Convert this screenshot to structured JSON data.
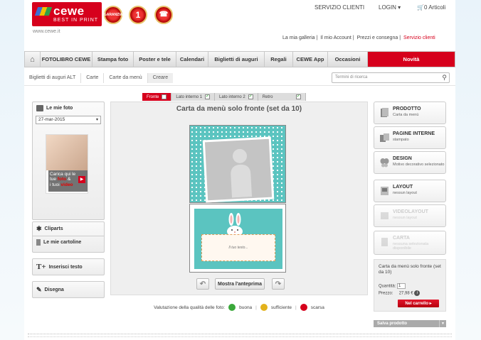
{
  "header": {
    "logo_word": "cewe",
    "logo_tag": "BEST IN PRINT",
    "site_url": "www.cewe.it",
    "badges": [
      {
        "icon": "garanzia-badge-icon",
        "label": "GARANZIA"
      },
      {
        "icon": "number-one-badge-icon",
        "label": "1"
      },
      {
        "icon": "phone-badge-icon",
        "label": "☎"
      }
    ],
    "servizio_clienti": "SERVIZIO CLIENTI",
    "login": "LOGIN",
    "cart": "0 Articoli",
    "sub_links": [
      "La mia galleria",
      "Il mio Account",
      "Prezzi e consegna",
      "Servizio clienti"
    ]
  },
  "nav": {
    "home_icon": "home-icon",
    "items": [
      "FOTOLIBRO CEWE",
      "Stampa foto",
      "Poster e tele",
      "Calendari",
      "Biglietti di auguri",
      "Regali",
      "CEWE App",
      "Occasioni",
      "Novità"
    ]
  },
  "breadcrumb": [
    "Biglietti di auguri ALT",
    "Carte",
    "Carte da menù",
    "Creare"
  ],
  "search": {
    "placeholder": "Termini di ricerca",
    "icon": "search-icon"
  },
  "tabs": [
    {
      "label": "Fronte",
      "checked": false
    },
    {
      "label": "Lato interno 1",
      "checked": true
    },
    {
      "label": "Lato interno 2",
      "checked": true
    },
    {
      "label": "Retro",
      "checked": true
    }
  ],
  "editor": {
    "title": "Carta da menù solo fronte (set da 10)",
    "note_text": "Il tuo testo...",
    "preview_button": "Mostra l'anteprima"
  },
  "quality": {
    "label": "Valutazione della qualità delle foto:",
    "levels": [
      {
        "label": "buona",
        "color": "#3aa83a"
      },
      {
        "label": "sufficiente",
        "color": "#e3b21c"
      },
      {
        "label": "scarsa",
        "color": "#d6001c"
      }
    ]
  },
  "left_panel": {
    "my_photos": "Le mie foto",
    "date": "27-mar-2015",
    "promo_line1": "Carica qui le",
    "promo_line2": "tue",
    "promo_red1": "foto",
    "promo_amp": "&",
    "promo_line3": "i tuoi",
    "promo_red2": "video",
    "cliparts": "Cliparts",
    "my_cards": "Le mie cartoline",
    "insert_text": "Inserisci testo",
    "draw": "Disegna"
  },
  "right_panel": {
    "boxes": [
      {
        "title": "PRODOTTO",
        "sub": "Carta da menù",
        "icon": "product-icon",
        "enabled": true
      },
      {
        "title": "PAGINE INTERNE",
        "sub": "stampato",
        "icon": "pages-icon",
        "enabled": true
      },
      {
        "title": "DESIGN",
        "sub": "Motivo decorativo selezionato",
        "icon": "butterfly-icon",
        "enabled": true
      },
      {
        "title": "LAYOUT",
        "sub": "nessun layout",
        "icon": "layout-icon",
        "enabled": true
      },
      {
        "title": "VIDEOLAYOUT",
        "sub": "nessun layout",
        "icon": "video-layout-icon",
        "enabled": false
      },
      {
        "title": "CARTA",
        "sub": "nessuna selezionata disponibile",
        "icon": "paper-icon",
        "enabled": false
      }
    ],
    "summary_name": "Carta da menù solo fronte (set da 10)",
    "qty_label": "Quantità:",
    "qty_value": "1",
    "price_label": "Prezzo:",
    "price_value": "27,98 €",
    "cart_button": "Nel carrello",
    "save_button": "Salva prodotto"
  }
}
